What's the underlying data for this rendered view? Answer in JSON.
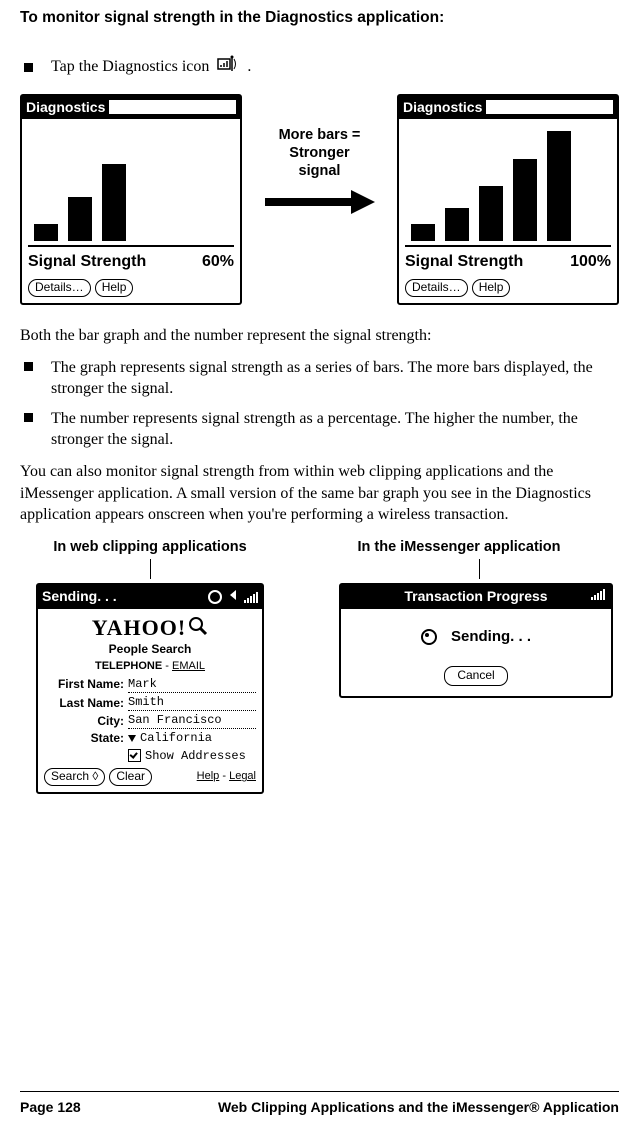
{
  "heading": "To monitor signal strength in the Diagnostics application:",
  "instruction": {
    "prefix": "Tap the Diagnostics icon",
    "suffix": " ."
  },
  "diagnostics_icon_name": "diagnostics-icon",
  "mid_label_l1": "More bars =",
  "mid_label_l2": "Stronger",
  "mid_label_l3": "signal",
  "panel60": {
    "title": "Diagnostics",
    "signal_label": "Signal Strength",
    "signal_value": "60%",
    "details_btn": "Details…",
    "help_btn": "Help"
  },
  "panel100": {
    "title": "Diagnostics",
    "signal_label": "Signal Strength",
    "signal_value": "100%",
    "details_btn": "Details…",
    "help_btn": "Help"
  },
  "para_intro": "Both the bar graph and the number represent the signal strength:",
  "bullets": [
    "The graph represents signal strength as a series of bars. The more bars displayed, the stronger the signal.",
    "The number represents signal strength as a percentage. The higher the number, the stronger the signal."
  ],
  "para_followup": "You can also monitor signal strength from within web clipping applications and the iMessenger application. A small version of the same bar graph you see in the Diagnostics application appears onscreen when you're performing a wireless transaction.",
  "callout_web_title": "In web clipping applications",
  "callout_imsg_title": "In the iMessenger application",
  "yahoo": {
    "sending": "Sending. . .",
    "logo": "YAHOO!",
    "sub": "People Search",
    "tabs_bold": "TELEPHONE",
    "tabs_sep": " - ",
    "tabs_link": "EMAIL",
    "first_label": "First Name:",
    "first_val": "Mark",
    "last_label": "Last Name:",
    "last_val": "Smith",
    "city_label": "City:",
    "city_val": "San Francisco",
    "state_label": "State:",
    "state_val": "California",
    "show_addresses": "Show Addresses",
    "search_btn": "Search",
    "clear_btn": "Clear",
    "help_link": "Help",
    "legal_link": "Legal"
  },
  "imsg": {
    "title": "Transaction Progress",
    "sending": "Sending. . .",
    "cancel": "Cancel"
  },
  "footer": {
    "page_label": "Page 128",
    "chapter": "Web Clipping Applications and the iMessenger® Application"
  },
  "chart_data": [
    {
      "type": "bar",
      "title": "Signal Strength 60%",
      "categories": [
        "bar1",
        "bar2",
        "bar3",
        "bar4",
        "bar5"
      ],
      "values": [
        15,
        40,
        70,
        0,
        0
      ],
      "ylim": [
        0,
        100
      ]
    },
    {
      "type": "bar",
      "title": "Signal Strength 100%",
      "categories": [
        "bar1",
        "bar2",
        "bar3",
        "bar4",
        "bar5"
      ],
      "values": [
        15,
        30,
        50,
        75,
        100
      ],
      "ylim": [
        0,
        100
      ]
    }
  ]
}
